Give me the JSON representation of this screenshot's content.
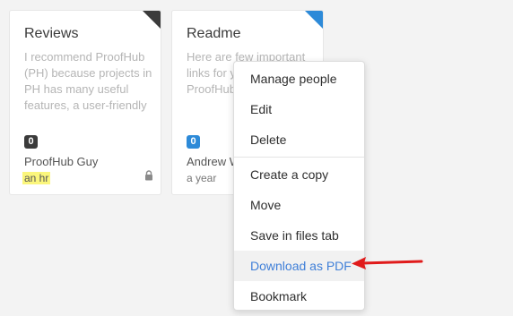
{
  "cards": [
    {
      "title": "Reviews",
      "description": "I recommend ProofHub (PH) because projects in PH has many useful features, a user-friendly",
      "count": "0",
      "count_color": "#3b3b3b",
      "corner_color": "#3b3b3b",
      "author": "ProofHub Guy",
      "time": "an hr",
      "icon": "lock-icon"
    },
    {
      "title": "Readme",
      "description": "Here are few important links for y us or shar for ProofHub",
      "count": "0",
      "count_color": "#2d8ad8",
      "corner_color": "#2d8ad8",
      "author": "Andrew W",
      "time": "a year"
    }
  ],
  "menu": {
    "items": [
      {
        "label": "Manage people"
      },
      {
        "label": "Edit"
      },
      {
        "label": "Delete"
      },
      {
        "label": "Create a copy"
      },
      {
        "label": "Move"
      },
      {
        "label": "Save in files tab"
      },
      {
        "label": "Download as PDF"
      },
      {
        "label": "Bookmark"
      }
    ],
    "active_item": "Download as PDF",
    "active_color": "#3f7fd8"
  },
  "annotation": {
    "arrow_color": "#e01b1b"
  }
}
